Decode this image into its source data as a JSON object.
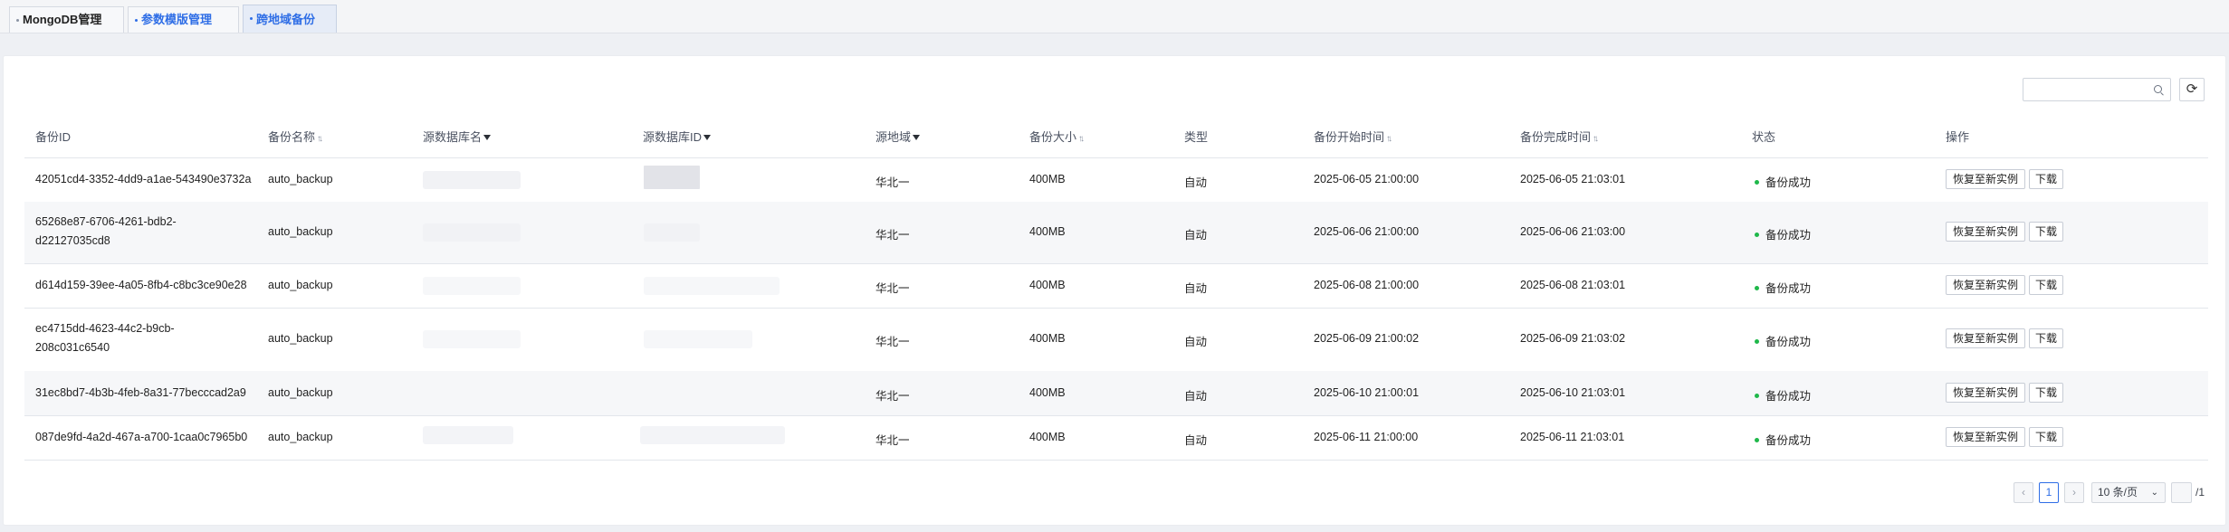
{
  "tabs": [
    {
      "label": "MongoDB管理"
    },
    {
      "label": "参数模版管理"
    },
    {
      "label": "跨地域备份"
    }
  ],
  "toolbar": {
    "search_placeholder": "",
    "refresh_icon": "refresh-icon"
  },
  "table": {
    "columns": [
      {
        "label": "备份ID"
      },
      {
        "label": "备份名称",
        "sortable": true
      },
      {
        "label": "源数据库名",
        "filter": true
      },
      {
        "label": "源数据库ID",
        "filter": true
      },
      {
        "label": "源地域",
        "filter": true
      },
      {
        "label": "备份大小",
        "sortable": true
      },
      {
        "label": "类型"
      },
      {
        "label": "备份开始时间",
        "sortable": true
      },
      {
        "label": "备份完成时间",
        "sortable": true
      },
      {
        "label": "状态"
      },
      {
        "label": "操作"
      }
    ],
    "rows": [
      {
        "id": "42051cd4-3352-4dd9-a1ae-543490e3732a",
        "name": "auto_backup",
        "region": "华北一",
        "size": "400MB",
        "type": "自动",
        "start": "2025-06-05 21:00:00",
        "end": "2025-06-05 21:03:01",
        "status": "备份成功",
        "restore": "恢复至新实例",
        "download": "下载"
      },
      {
        "id": "65268e87-6706-4261-bdb2-d22127035cd8",
        "name": "auto_backup",
        "region": "华北一",
        "size": "400MB",
        "type": "自动",
        "start": "2025-06-06 21:00:00",
        "end": "2025-06-06 21:03:00",
        "status": "备份成功",
        "restore": "恢复至新实例",
        "download": "下载"
      },
      {
        "id": "d614d159-39ee-4a05-8fb4-c8bc3ce90e28",
        "name": "auto_backup",
        "region": "华北一",
        "size": "400MB",
        "type": "自动",
        "start": "2025-06-08 21:00:00",
        "end": "2025-06-08 21:03:01",
        "status": "备份成功",
        "restore": "恢复至新实例",
        "download": "下载"
      },
      {
        "id": "ec4715dd-4623-44c2-b9cb-208c031c6540",
        "name": "auto_backup",
        "region": "华北一",
        "size": "400MB",
        "type": "自动",
        "start": "2025-06-09 21:00:02",
        "end": "2025-06-09 21:03:02",
        "status": "备份成功",
        "restore": "恢复至新实例",
        "download": "下载"
      },
      {
        "id": "31ec8bd7-4b3b-4feb-8a31-77becccad2a9",
        "name": "auto_backup",
        "region": "华北一",
        "size": "400MB",
        "type": "自动",
        "start": "2025-06-10 21:00:01",
        "end": "2025-06-10 21:03:01",
        "status": "备份成功",
        "restore": "恢复至新实例",
        "download": "下载"
      },
      {
        "id": "087de9fd-4a2d-467a-a700-1caa0c7965b0",
        "name": "auto_backup",
        "region": "华北一",
        "size": "400MB",
        "type": "自动",
        "start": "2025-06-11 21:00:00",
        "end": "2025-06-11 21:03:01",
        "status": "备份成功",
        "restore": "恢复至新实例",
        "download": "下载"
      }
    ]
  },
  "pagination": {
    "prev": "‹",
    "current": "1",
    "next": "›",
    "page_size": "10 条/页",
    "jump_value": "",
    "total_pages": "/1"
  },
  "colors": {
    "accent": "#2f6ee6",
    "success": "#1fb84a"
  }
}
